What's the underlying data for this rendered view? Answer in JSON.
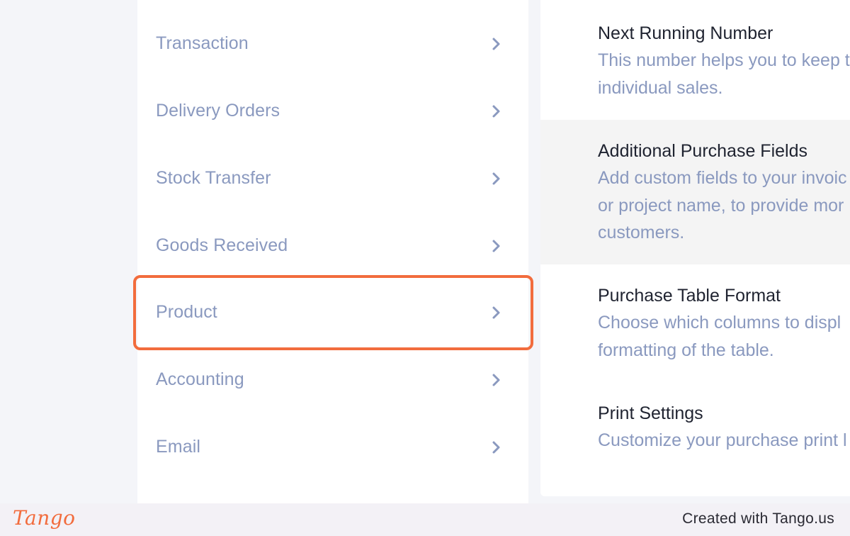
{
  "settings_menu": {
    "items": [
      {
        "label": "Transaction"
      },
      {
        "label": "Delivery Orders"
      },
      {
        "label": "Stock Transfer"
      },
      {
        "label": "Goods Received"
      },
      {
        "label": "Product"
      },
      {
        "label": "Accounting"
      },
      {
        "label": "Email"
      }
    ],
    "highlighted_item": "Product",
    "chevron_icon": "chevron-right-icon"
  },
  "options_panel": {
    "items": [
      {
        "title": "Next Running Number",
        "desc_lines": [
          "This number helps you to keep t",
          "individual sales."
        ]
      },
      {
        "title": "Additional Purchase Fields",
        "desc_lines": [
          "Add custom fields to your invoic",
          "or project name, to provide mor",
          "customers."
        ]
      },
      {
        "title": "Purchase Table Format",
        "desc_lines": [
          "Choose which columns to displ",
          "formatting of the table."
        ]
      },
      {
        "title": "Print Settings",
        "desc_lines": [
          "Customize your purchase print l"
        ]
      }
    ]
  },
  "footer": {
    "logo_text": "Tango",
    "credit": "Created with Tango.us"
  },
  "colors": {
    "highlight": "#f26c3d",
    "menu_text": "#8a99bf",
    "title_text": "#1f2330"
  }
}
